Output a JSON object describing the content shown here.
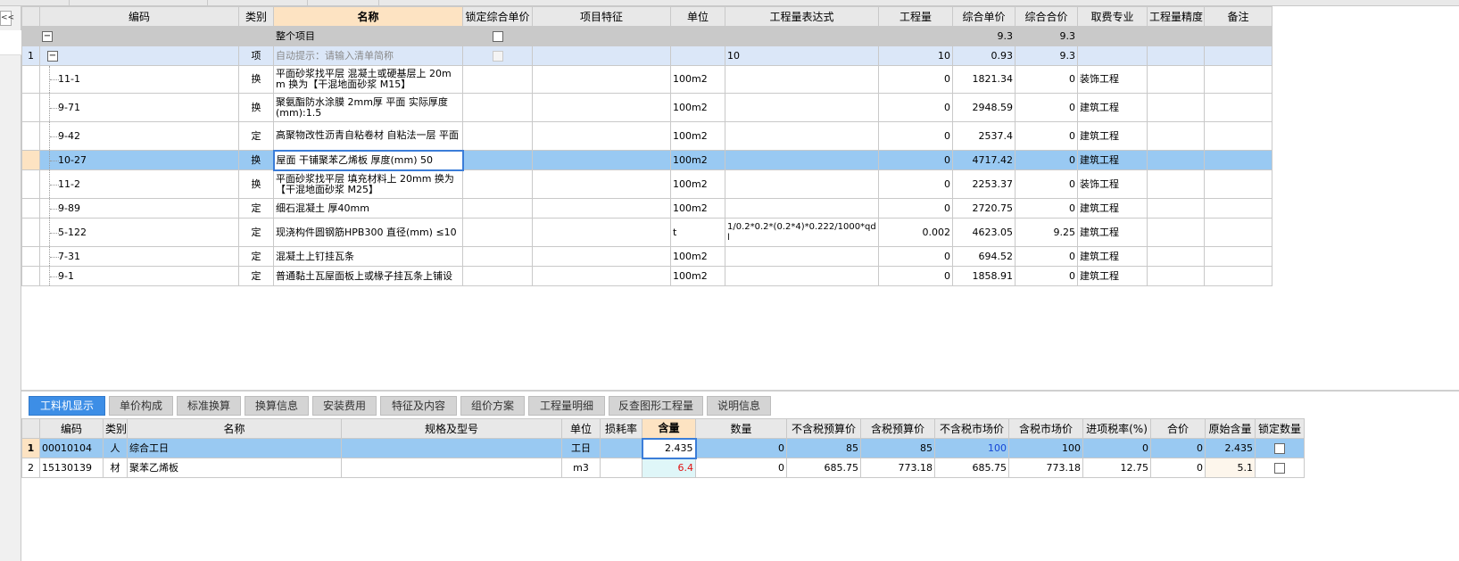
{
  "grid": {
    "columns": [
      "编码",
      "类别",
      "名称",
      "锁定综合单价",
      "项目特征",
      "单位",
      "工程量表达式",
      "工程量",
      "综合单价",
      "综合合价",
      "取费专业",
      "工程量精度",
      "备注"
    ],
    "total_row": {
      "collapse": "−",
      "label": "整个项目",
      "unit_price": "9.3",
      "total": "9.3"
    },
    "item_row": {
      "num": "1",
      "collapse": "−",
      "type": "项",
      "name_hint": "自动提示：请输入清单简称",
      "expr": "10",
      "qty": "10",
      "unit_price": "0.93",
      "total": "9.3"
    },
    "rows": [
      {
        "code": "11-1",
        "type": "换",
        "name": "平面砂浆找平层 混凝土或硬基层上 20mm 换为【干混地面砂浆 M15】",
        "unit": "100m2",
        "expr": "",
        "qty": "0",
        "unit_price": "1821.34",
        "total": "0",
        "fee": "装饰工程"
      },
      {
        "code": "9-71",
        "type": "换",
        "name": "聚氨酯防水涂膜 2mm厚 平面 实际厚度(mm):1.5",
        "unit": "100m2",
        "expr": "",
        "qty": "0",
        "unit_price": "2948.59",
        "total": "0",
        "fee": "建筑工程"
      },
      {
        "code": "9-42",
        "type": "定",
        "name": "高聚物改性沥青自粘卷材 自粘法一层 平面",
        "unit": "100m2",
        "expr": "",
        "qty": "0",
        "unit_price": "2537.4",
        "total": "0",
        "fee": "建筑工程"
      },
      {
        "code": "10-27",
        "type": "换",
        "name": "屋面 干铺聚苯乙烯板 厚度(mm) 50",
        "unit": "100m2",
        "expr": "",
        "qty": "0",
        "unit_price": "4717.42",
        "total": "0",
        "fee": "建筑工程"
      },
      {
        "code": "11-2",
        "type": "换",
        "name": "平面砂浆找平层 填充材料上 20mm 换为【干混地面砂浆 M25】",
        "unit": "100m2",
        "expr": "",
        "qty": "0",
        "unit_price": "2253.37",
        "total": "0",
        "fee": "装饰工程"
      },
      {
        "code": "9-89",
        "type": "定",
        "name": "细石混凝土 厚40mm",
        "unit": "100m2",
        "expr": "",
        "qty": "0",
        "unit_price": "2720.75",
        "total": "0",
        "fee": "建筑工程"
      },
      {
        "code": "5-122",
        "type": "定",
        "name": "现浇构件圆钢筋HPB300 直径(mm) ≤10",
        "unit": "t",
        "expr": "1/0.2*0.2*(0.2*4)*0.222/1000*qdl",
        "qty": "0.002",
        "unit_price": "4623.05",
        "total": "9.25",
        "fee": "建筑工程"
      },
      {
        "code": "7-31",
        "type": "定",
        "name": "混凝土上钉挂瓦条",
        "unit": "100m2",
        "expr": "",
        "qty": "0",
        "unit_price": "694.52",
        "total": "0",
        "fee": "建筑工程"
      },
      {
        "code": "9-1",
        "type": "定",
        "name": "普通黏土瓦屋面板上或椽子挂瓦条上铺设",
        "unit": "100m2",
        "expr": "",
        "qty": "0",
        "unit_price": "1858.91",
        "total": "0",
        "fee": "建筑工程"
      }
    ]
  },
  "tabs": [
    "工料机显示",
    "单价构成",
    "标准换算",
    "换算信息",
    "安装费用",
    "特征及内容",
    "组价方案",
    "工程量明细",
    "反查图形工程量",
    "说明信息"
  ],
  "sub": {
    "columns": [
      "编码",
      "类别",
      "名称",
      "规格及型号",
      "单位",
      "损耗率",
      "含量",
      "数量",
      "不含税预算价",
      "含税预算价",
      "不含税市场价",
      "含税市场价",
      "进项税率(%)",
      "合价",
      "原始含量",
      "锁定数量"
    ],
    "rows": [
      {
        "num": "1",
        "code": "00010104",
        "type": "人",
        "name": "综合工日",
        "spec": "",
        "unit": "工日",
        "loss": "",
        "content": "2.435",
        "qty": "0",
        "p1": "85",
        "p2": "85",
        "p3": "100",
        "p4": "100",
        "tax": "0",
        "total": "0",
        "orig": "2.435"
      },
      {
        "num": "2",
        "code": "15130139",
        "type": "材",
        "name": "聚苯乙烯板",
        "spec": "",
        "unit": "m3",
        "loss": "",
        "content": "6.4",
        "qty": "0",
        "p1": "685.75",
        "p2": "773.18",
        "p3": "685.75",
        "p4": "773.18",
        "tax": "12.75",
        "total": "0",
        "orig": "5.1"
      }
    ]
  },
  "left": {
    "collapse": "<<"
  }
}
